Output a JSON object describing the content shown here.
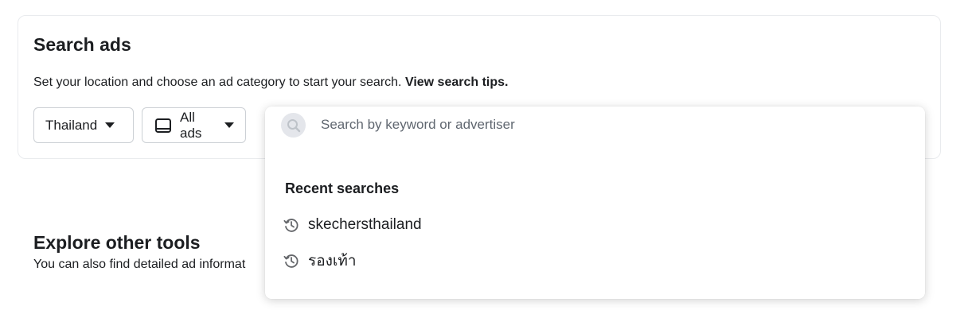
{
  "search_ads": {
    "title": "Search ads",
    "description": "Set your location and choose an ad category to start your search. ",
    "tips_link": "View search tips.",
    "country": {
      "selected": "Thailand"
    },
    "category": {
      "selected": "All ads",
      "icon": "tablet-icon"
    }
  },
  "explore": {
    "title": "Explore other tools",
    "description": "You can also find detailed ad informat"
  },
  "search_dropdown": {
    "placeholder": "Search by keyword or advertiser",
    "search_icon": "search-icon",
    "recent_heading": "Recent searches",
    "recent_searches": [
      {
        "label": "skechersthailand",
        "icon": "history-icon"
      },
      {
        "label": "รองเท้า",
        "icon": "history-icon"
      }
    ]
  }
}
